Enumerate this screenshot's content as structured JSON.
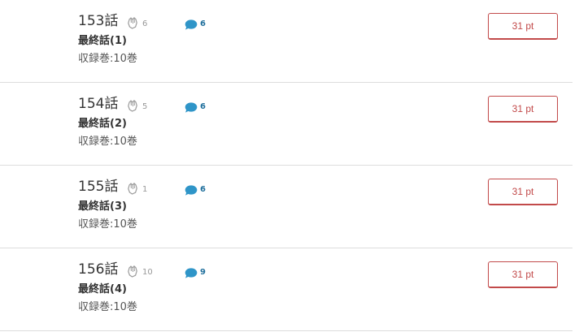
{
  "colors": {
    "accent": "#c24a4a",
    "comment_icon": "#2f95c8",
    "divider": "#dddddd"
  },
  "episodes": [
    {
      "title": "153話",
      "clap_count": "6",
      "comment_count": "6",
      "subtitle": "最終話(1)",
      "volume": "収録巻:10巻",
      "price": "31 pt"
    },
    {
      "title": "154話",
      "clap_count": "5",
      "comment_count": "6",
      "subtitle": "最終話(2)",
      "volume": "収録巻:10巻",
      "price": "31 pt"
    },
    {
      "title": "155話",
      "clap_count": "1",
      "comment_count": "6",
      "subtitle": "最終話(3)",
      "volume": "収録巻:10巻",
      "price": "31 pt"
    },
    {
      "title": "156話",
      "clap_count": "10",
      "comment_count": "9",
      "subtitle": "最終話(4)",
      "volume": "収録巻:10巻",
      "price": "31 pt"
    }
  ],
  "icons": {
    "clap": "clap-hands-icon",
    "comment": "comment-bubble-icon"
  }
}
